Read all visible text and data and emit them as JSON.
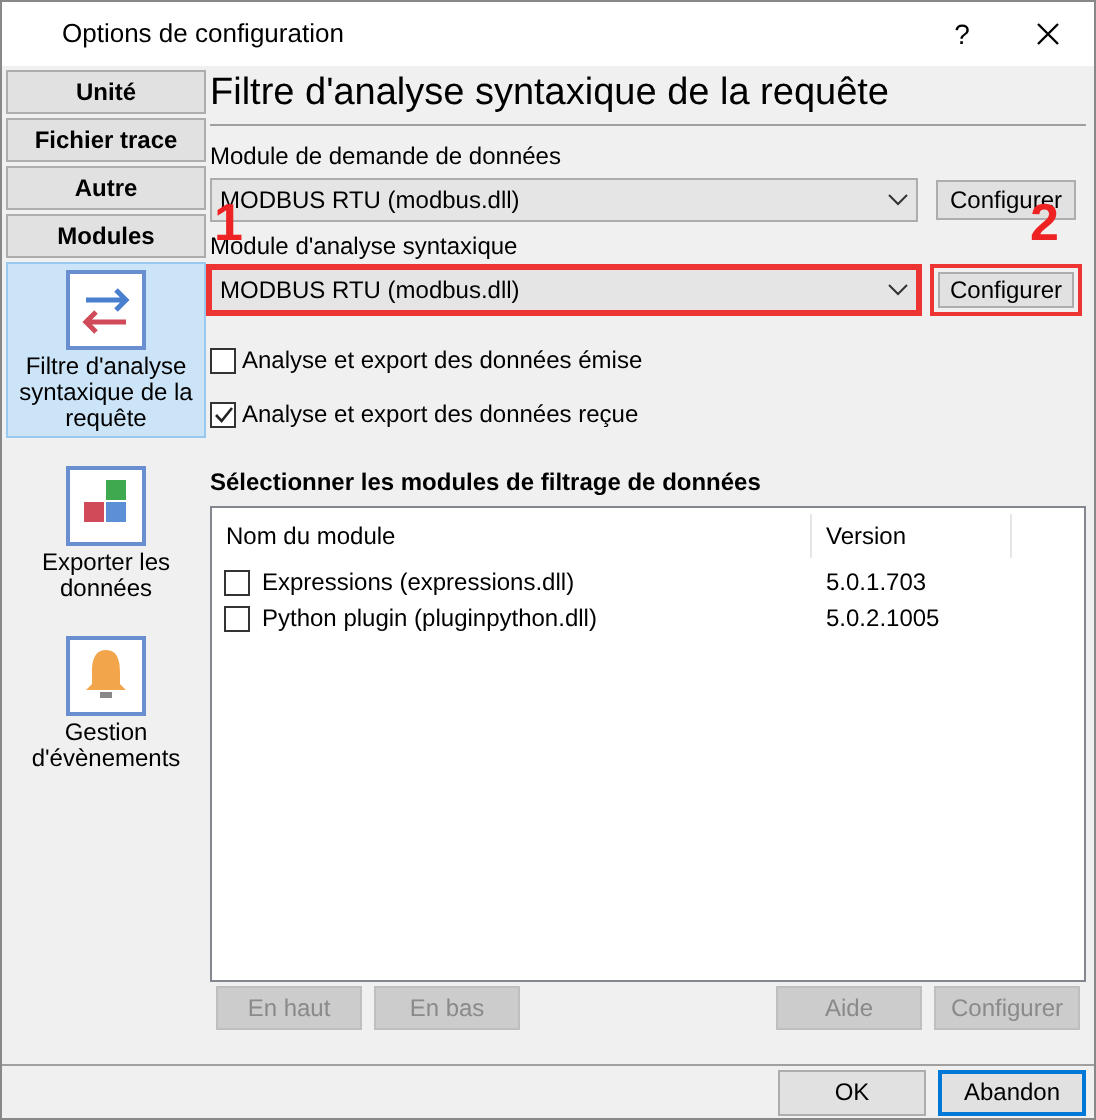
{
  "window": {
    "title": "Options de configuration",
    "help": "?"
  },
  "sidebar": {
    "items": [
      {
        "kind": "button",
        "label": "Unité",
        "selected": false
      },
      {
        "kind": "button",
        "label": "Fichier trace",
        "selected": false
      },
      {
        "kind": "button",
        "label": "Autre",
        "selected": false
      },
      {
        "kind": "button",
        "label": "Modules",
        "selected": false
      },
      {
        "kind": "tile",
        "label": "Filtre d'analyse syntaxique de la requête",
        "selected": true
      },
      {
        "kind": "tile",
        "label": "Exporter les données",
        "selected": false
      },
      {
        "kind": "tile",
        "label": "Gestion d'évènements",
        "selected": false
      }
    ]
  },
  "page": {
    "title": "Filtre d'analyse syntaxique de la requête",
    "fields": [
      {
        "label": "Module de demande de données",
        "value": "MODBUS RTU (modbus.dll)",
        "button": "Configurer",
        "highlighted": false,
        "button_highlighted": false
      },
      {
        "label": "Module d'analyse syntaxique",
        "value": "MODBUS RTU (modbus.dll)",
        "button": "Configurer",
        "highlighted": true,
        "button_highlighted": true
      }
    ],
    "checkboxes": [
      {
        "label": "Analyse et export des données émise",
        "checked": false
      },
      {
        "label": "Analyse et export des données reçue",
        "checked": true
      }
    ],
    "section_title": "Sélectionner les modules de filtrage de données",
    "table": {
      "columns": [
        "Nom du module",
        "Version"
      ],
      "rows": [
        {
          "name": "Expressions (expressions.dll)",
          "version": "5.0.1.703",
          "checked": false
        },
        {
          "name": "Python plugin (pluginpython.dll)",
          "version": "5.0.2.1005",
          "checked": false
        }
      ]
    },
    "list_buttons": [
      {
        "label": "En haut",
        "disabled": true
      },
      {
        "label": "En bas",
        "disabled": true
      },
      {
        "label": "Aide",
        "disabled": true
      },
      {
        "label": "Configurer",
        "disabled": true
      }
    ]
  },
  "annotations": [
    "1",
    "2"
  ],
  "footer_buttons": [
    {
      "label": "OK",
      "default": false
    },
    {
      "label": "Abandon",
      "default": true
    }
  ]
}
